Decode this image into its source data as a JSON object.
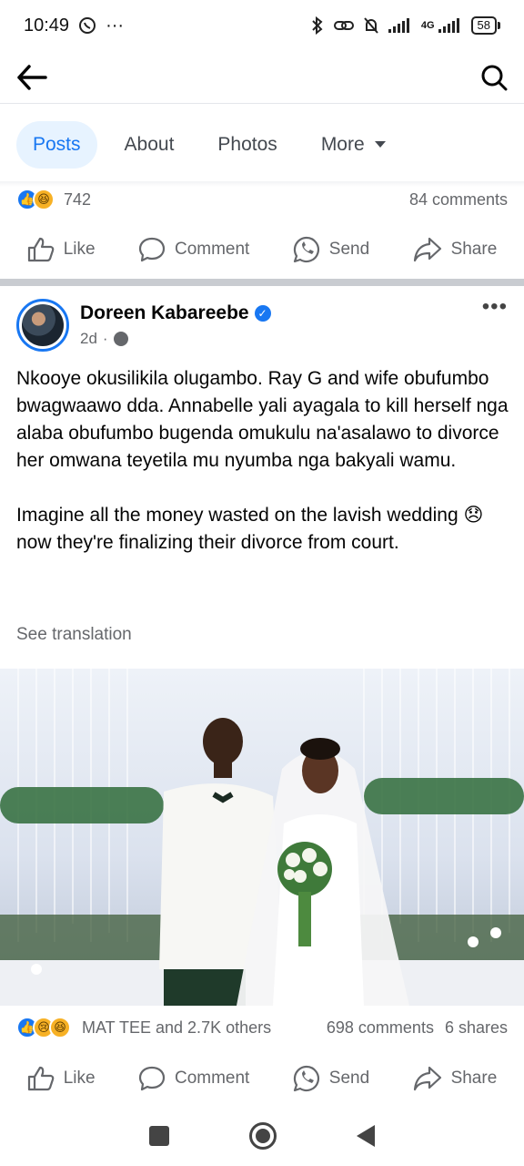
{
  "status_bar": {
    "time": "10:49",
    "dots": "···",
    "battery": "58",
    "network": "4G"
  },
  "tabs": [
    {
      "label": "Posts"
    },
    {
      "label": "About"
    },
    {
      "label": "Photos"
    },
    {
      "label": "More"
    }
  ],
  "prev_post": {
    "reaction_count": "742",
    "comments": "84 comments",
    "actions": {
      "like": "Like",
      "comment": "Comment",
      "send": "Send",
      "share": "Share"
    }
  },
  "post": {
    "author": "Doreen Kabareebe",
    "time": "2d",
    "paragraph1": "Nkooye okusilikila olugambo. Ray G and wife obufumbo bwagwaawo dda. Annabelle yali ayagala to kill herself nga alaba obufumbo bugenda omukulu na'asalawo to divorce her omwana teyetila mu nyumba nga bakyali wamu.",
    "paragraph2_a": "Imagine all the money wasted on the lavish wedding",
    "paragraph2_emoji": "😞",
    "paragraph2_b": "now they're finalizing their divorce from court.",
    "see_translation": "See translation",
    "reactions_summary": "MAT TEE and 2.7K others",
    "comments": "698 comments",
    "shares": "6 shares",
    "actions": {
      "like": "Like",
      "comment": "Comment",
      "send": "Send",
      "share": "Share"
    }
  },
  "colors": {
    "accent": "#1877f2",
    "muted": "#65676b",
    "tab_active_bg": "#e7f3ff"
  }
}
